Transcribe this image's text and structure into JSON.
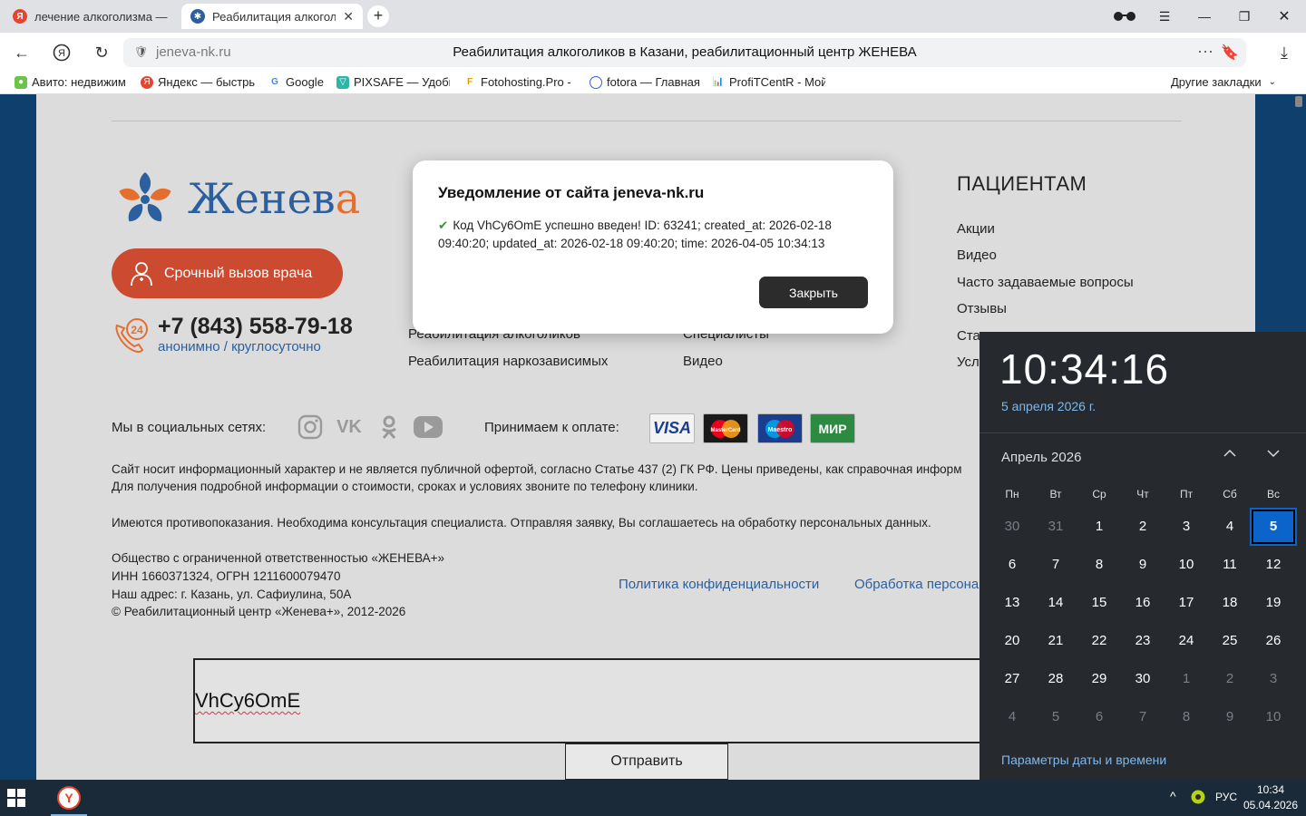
{
  "browser": {
    "tabs": [
      {
        "label": "лечение алкоголизма — Я",
        "favicon": "yandex-icon"
      },
      {
        "label": "Реабилитация алкоголиков",
        "favicon": "zheneva-icon",
        "active": true
      }
    ],
    "domain": "jeneva-nk.ru",
    "page_title": "Реабилитация алкоголиков в Казани, реабилитационный центр ЖЕНЕВА",
    "bookmarks": [
      "Авито: недвижим",
      "Яндекс — быстры",
      "Google",
      "PIXSAFE — Удобн",
      "Fotohosting.Pro - ",
      "fotora — Главная",
      "ProfiTCentR - Мой"
    ],
    "other_bookmarks": "Другие закладки"
  },
  "site": {
    "logo_text_main": "Женев",
    "logo_text_accent": "а",
    "urgent_button": "Срочный вызов врача",
    "phone": "+7 (843) 558-79-18",
    "phone_sub": "анонимно / круглосуточно",
    "col1_links": [
      "Реабилитация алкоголиков",
      "Реабилитация наркозависимых"
    ],
    "col2_links": [
      "Специалисты",
      "Видео"
    ],
    "patients_heading": "ПАЦИЕНТАМ",
    "patients_links": [
      "Акции",
      "Видео",
      "Часто задаваемые вопросы",
      "Отзывы",
      "Ста",
      "Усл"
    ],
    "social_label": "Мы в социальных сетях:",
    "payment_label": "Принимаем к оплате:",
    "cards": [
      "VISA",
      "MasterCard",
      "Maestro",
      "МИР"
    ],
    "legal_line1": "Сайт носит информационный характер и не является публичной офертой, согласно Статье 437 (2) ГК РФ. Цены приведены, как справочная информ",
    "legal_line2": "Для получения подробной информации о стоимости, сроках и условиях звоните по телефону клиники.",
    "legal_line3": "Имеются противопоказания. Необходима консультация специалиста. Отправляя заявку, Вы соглашаетесь на обработку персональных данных.",
    "company": "Общество с ограниченной ответственностью «ЖЕНЕВА+»",
    "inn": "ИНН 1660371324, ОГРН 1211600079470",
    "address": "Наш адрес: г. Казань, ул. Сафиулина, 50А",
    "copyright": "© Реабилитационный центр «Женева+», 2012-2026",
    "privacy_link": "Политика конфиденциальности",
    "processing_link": "Обработка персона",
    "code_value": "VhCy6OmE",
    "submit_button": "Отправить"
  },
  "modal": {
    "title": "Уведомление от сайта jeneva-nk.ru",
    "message": "Код VhCy6OmE успешно введен! ID: 63241; created_at: 2026-02-18 09:40:20; updated_at: 2026-02-18 09:40:20; time: 2026-04-05 10:34:13",
    "close_button": "Закрыть"
  },
  "clock_flyout": {
    "time": "10:34:16",
    "date": "5 апреля 2026 г.",
    "month": "Апрель 2026",
    "weekdays": [
      "Пн",
      "Вт",
      "Ср",
      "Чт",
      "Пт",
      "Сб",
      "Вс"
    ],
    "days": [
      [
        "30",
        "31",
        "1",
        "2",
        "3",
        "4",
        "5"
      ],
      [
        "6",
        "7",
        "8",
        "9",
        "10",
        "11",
        "12"
      ],
      [
        "13",
        "14",
        "15",
        "16",
        "17",
        "18",
        "19"
      ],
      [
        "20",
        "21",
        "22",
        "23",
        "24",
        "25",
        "26"
      ],
      [
        "27",
        "28",
        "29",
        "30",
        "1",
        "2",
        "3"
      ],
      [
        "4",
        "5",
        "6",
        "7",
        "8",
        "9",
        "10"
      ]
    ],
    "today": "5",
    "settings_link": "Параметры даты и времени"
  },
  "taskbar": {
    "language": "РУС",
    "time": "10:34",
    "date": "05.04.2026"
  }
}
